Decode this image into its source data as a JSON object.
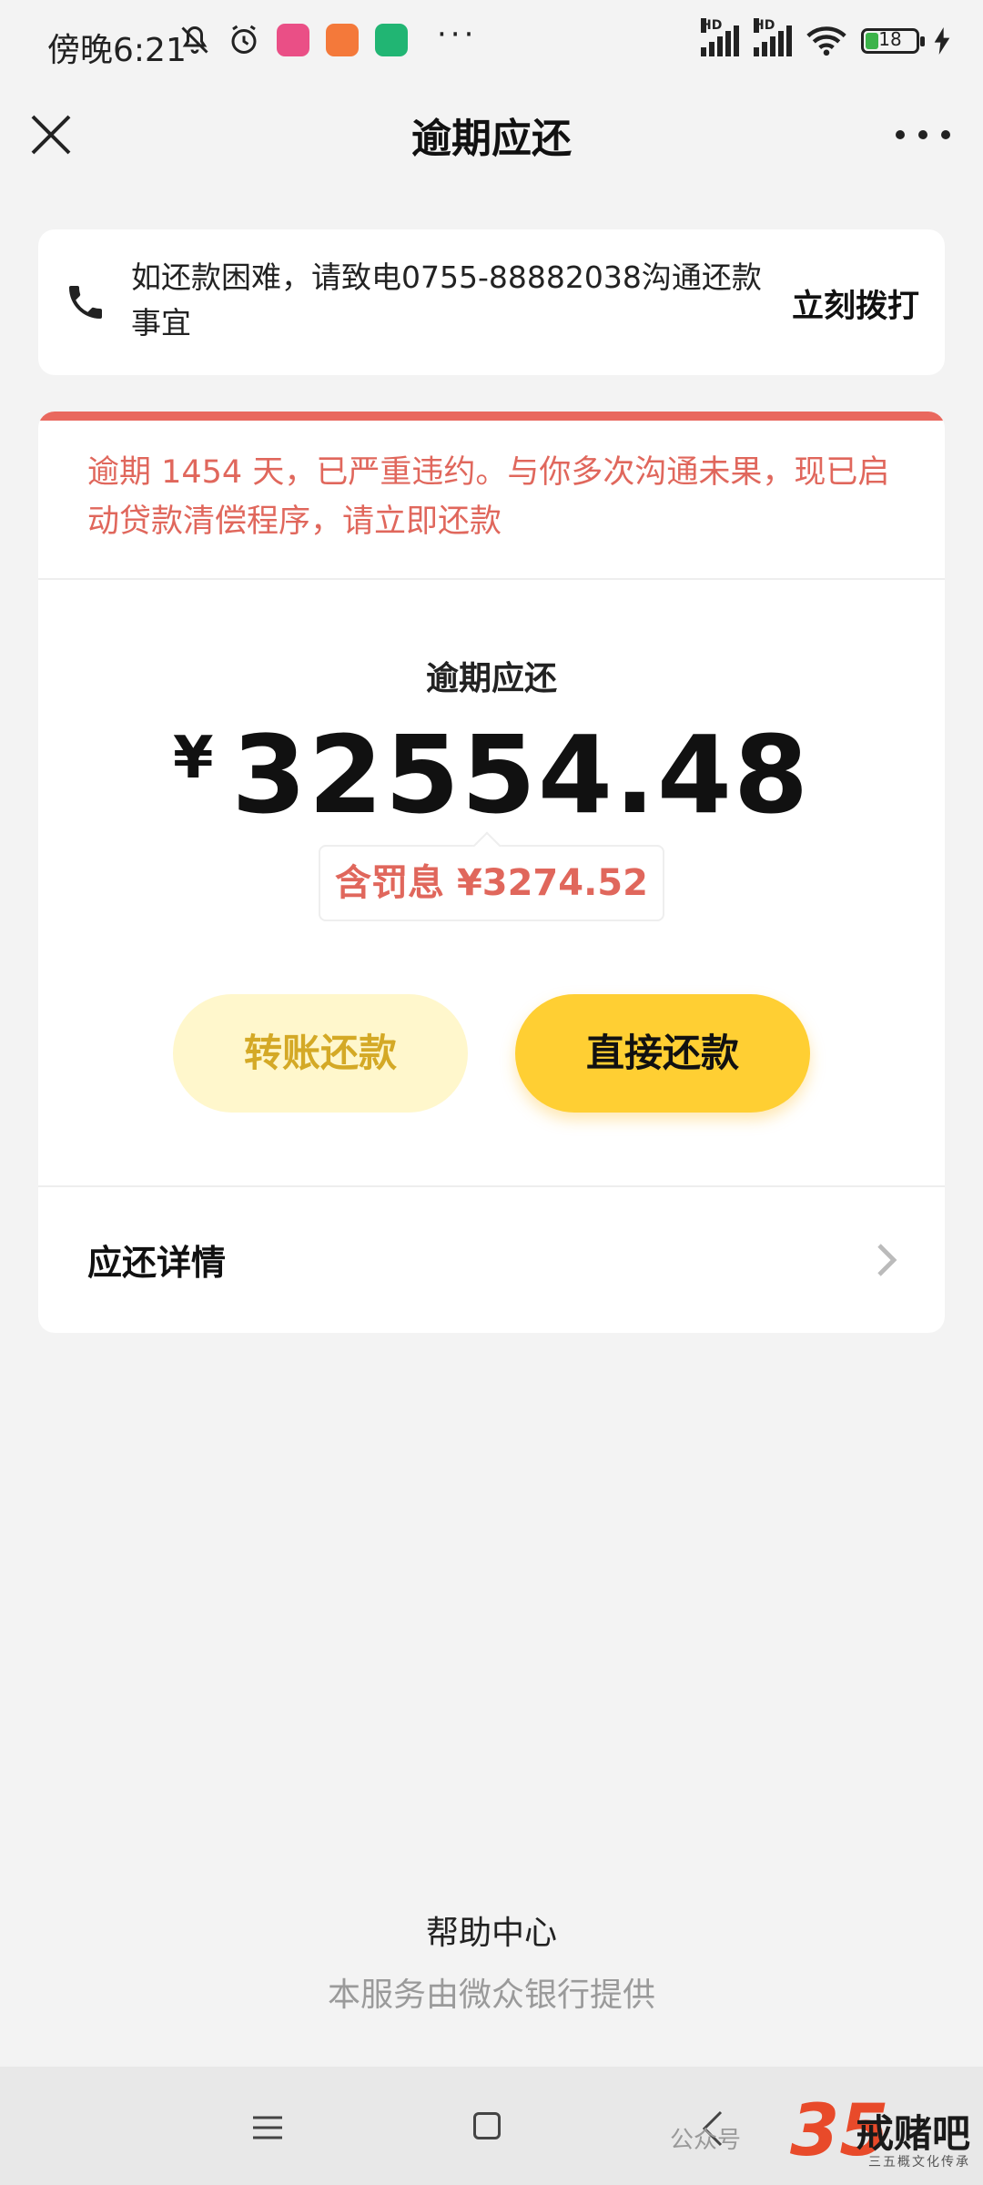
{
  "status_bar": {
    "time": "傍晚6:21",
    "hd1": "HD",
    "hd2": "HD",
    "battery": "18",
    "more": "···"
  },
  "nav": {
    "title": "逾期应还"
  },
  "notice": {
    "text": "如还款困难，请致电0755-88882038沟通还款事宜",
    "call_label": "立刻拨打"
  },
  "warning": {
    "text": "逾期 1454 天，已严重违约。与你多次沟通未果，现已启动贷款清偿程序，请立即还款"
  },
  "amount": {
    "label": "逾期应还",
    "currency": "¥",
    "value": "32554.48",
    "penalty": "含罚息 ¥3274.52"
  },
  "buttons": {
    "transfer": "转账还款",
    "direct": "直接还款"
  },
  "details": {
    "label": "应还详情"
  },
  "footer": {
    "help": "帮助中心",
    "provider": "本服务由微众银行提供"
  },
  "watermark": {
    "text": "公众号",
    "logo_num": "35",
    "logo_text": "戒赌吧",
    "logo_sub": "三五概文化传承"
  },
  "colors": {
    "accent_yellow": "#ffcf33",
    "light_yellow": "#fff7cc",
    "warning_red": "#e0675c",
    "background": "#f3f3f3"
  }
}
